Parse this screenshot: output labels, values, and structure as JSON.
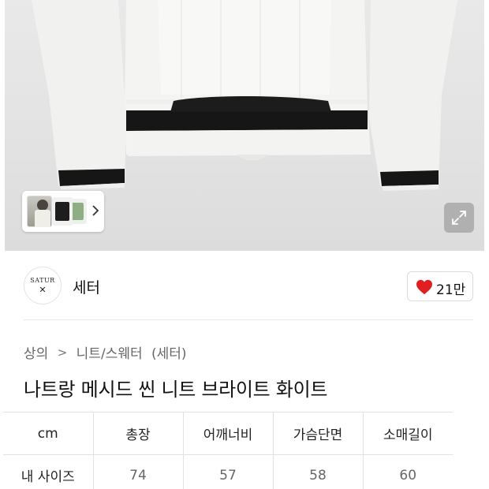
{
  "gallery": {
    "thumbnail_count": 3,
    "thumbnails": [
      "model-photo",
      "black-variant",
      "green-variant"
    ],
    "next_icon": "chevron-right-icon",
    "expand_icon": "expand-arrows-icon"
  },
  "brand": {
    "logo_text": "SATUR",
    "logo_mark": "✕",
    "name": "세터"
  },
  "like": {
    "icon": "heart-icon",
    "count": "21만",
    "color": "#e02020"
  },
  "breadcrumb": {
    "level1": "상의",
    "separator": ">",
    "level2": "니트/스웨터",
    "brand_tag": "(세터)"
  },
  "product": {
    "title": "나트랑 메시드 씬 니트 브라이트 화이트"
  },
  "size_table": {
    "headers": [
      "cm",
      "총장",
      "어깨너비",
      "가슴단면",
      "소매길이"
    ],
    "rows": [
      {
        "label": "내 사이즈",
        "values": [
          "74",
          "57",
          "58",
          "60"
        ]
      }
    ]
  }
}
